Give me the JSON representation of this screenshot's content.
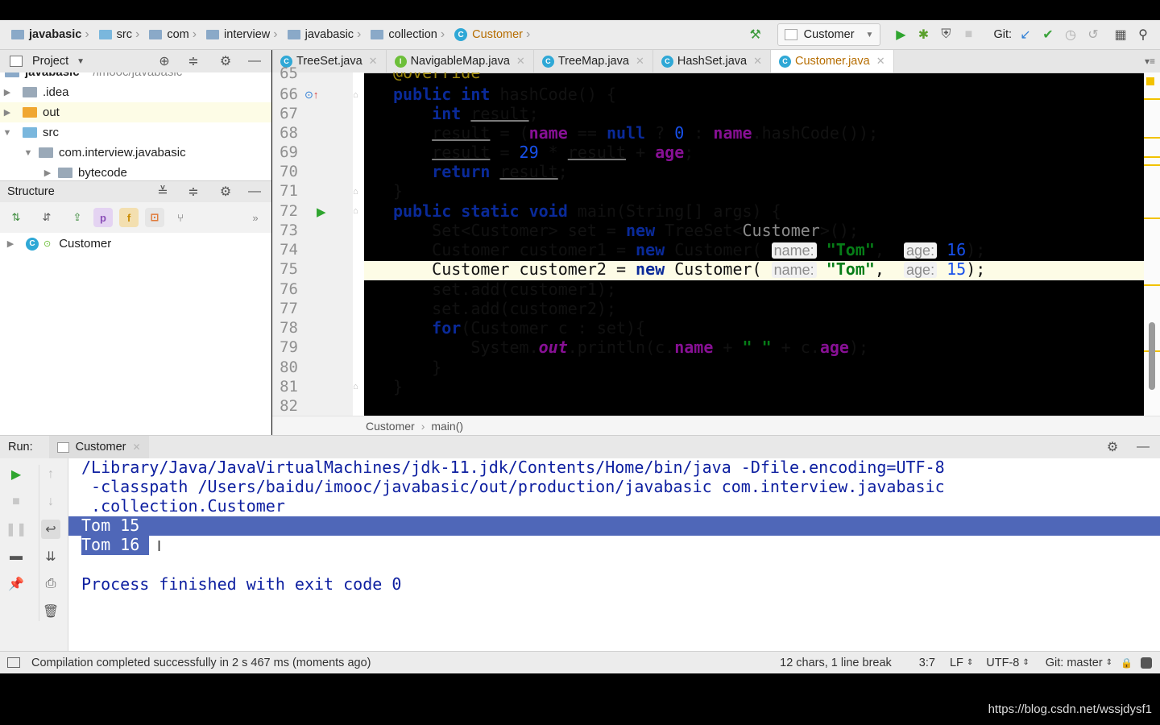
{
  "breadcrumbs": [
    "javabasic",
    "src",
    "com",
    "interview",
    "javabasic",
    "collection",
    "Customer"
  ],
  "toolbar": {
    "run_config": "Customer",
    "git_label": "Git:"
  },
  "project_panel": {
    "title": "Project",
    "root_label": "javabasic",
    "root_path": "~/imooc/javabasic",
    "items": [
      {
        "label": ".idea"
      },
      {
        "label": "out"
      },
      {
        "label": "src"
      },
      {
        "label": "com.interview.javabasic"
      },
      {
        "label": "bytecode"
      }
    ]
  },
  "structure_panel": {
    "title": "Structure",
    "badges": [
      "p",
      "f"
    ],
    "item": "Customer"
  },
  "tabs": [
    "TreeSet.java",
    "NavigableMap.java",
    "TreeMap.java",
    "HashSet.java",
    "Customer.java"
  ],
  "tab_badges": [
    "C",
    "I",
    "C",
    "C",
    "C"
  ],
  "editor": {
    "line_numbers": [
      "65",
      "66",
      "67",
      "68",
      "69",
      "70",
      "71",
      "72",
      "73",
      "74",
      "75",
      "76",
      "77",
      "78",
      "79",
      "80",
      "81",
      "82"
    ],
    "code_65": "@Override",
    "breadcrumb_class": "Customer",
    "breadcrumb_method": "main()",
    "highlight_line": 75
  },
  "run_panel": {
    "label": "Run:",
    "tab": "Customer",
    "output": [
      "/Library/Java/JavaVirtualMachines/jdk-11.jdk/Contents/Home/bin/java -Dfile.encoding=UTF-8",
      " -classpath /Users/baidu/imooc/javabasic/out/production/javabasic com.interview.javabasic",
      " .collection.Customer",
      "Tom 15",
      "Tom 16",
      "",
      "Process finished with exit code 0"
    ]
  },
  "status_bar": {
    "message": "Compilation completed successfully in 2 s 467 ms (moments ago)",
    "selection": "12 chars, 1 line break",
    "position": "3:7",
    "line_sep": "LF",
    "encoding": "UTF-8",
    "git_branch": "Git: master"
  },
  "watermark": "https://blog.csdn.net/wssjdysf1",
  "colors": {
    "selection": "#4f67b8",
    "keyword": "#0a2a99",
    "string": "#067d17",
    "field": "#871094",
    "console_text": "#0d1fa0"
  }
}
